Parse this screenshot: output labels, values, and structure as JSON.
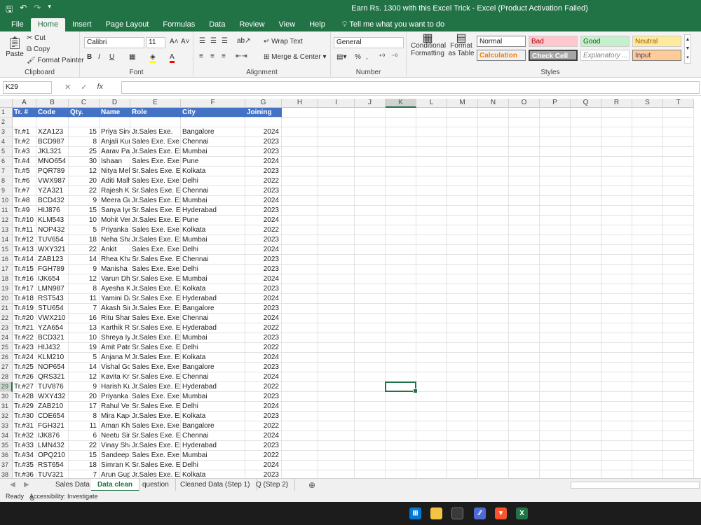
{
  "window": {
    "title": "Earn Rs. 1300 with this Excel Trick  -  Excel (Product Activation Failed)"
  },
  "menu": {
    "tabs": [
      "File",
      "Home",
      "Insert",
      "Page Layout",
      "Formulas",
      "Data",
      "Review",
      "View",
      "Help"
    ],
    "tellme": "Tell me what you want to do"
  },
  "ribbon": {
    "clipboard": {
      "paste": "Paste",
      "cut": "Cut",
      "copy": "Copy",
      "format_painter": "Format Painter",
      "label": "Clipboard"
    },
    "font": {
      "name": "Calibri",
      "size": "11",
      "bold": "B",
      "italic": "I",
      "underline": "U",
      "label": "Font"
    },
    "alignment": {
      "wrap": "Wrap Text",
      "merge": "Merge & Center",
      "label": "Alignment"
    },
    "number": {
      "format": "General",
      "percent": "%",
      "label": "Number"
    },
    "styles": {
      "conditional": "Conditional Formatting",
      "format_table": "Format as Table",
      "normal": "Normal",
      "bad": "Bad",
      "good": "Good",
      "neutral": "Neutral",
      "calculation": "Calculation",
      "check_cell": "Check Cell",
      "explanatory": "Explanatory ...",
      "input": "Input",
      "label": "Styles"
    }
  },
  "formula_bar": {
    "name_box": "K29",
    "fx": "fx",
    "value": ""
  },
  "columns": [
    "A",
    "B",
    "C",
    "D",
    "E",
    "F",
    "G",
    "H",
    "I",
    "J",
    "K",
    "L",
    "M",
    "N",
    "O",
    "P",
    "Q",
    "R",
    "S",
    "T"
  ],
  "selected_column": "K",
  "selected_row": 29,
  "header_row": [
    "Tr. #",
    "Code",
    "Qty.",
    "Name",
    "Role",
    "City",
    "Joining"
  ],
  "rows": [
    [
      "Tr.#1",
      "XZA123",
      "15",
      "Priya Sing",
      "Jr.Sales Exe.",
      "Bangalore",
      "2024"
    ],
    [
      "Tr.#2",
      "BCD987",
      "8",
      "Anjali Kun",
      "Sales Exe. Exe.",
      "Chennai",
      "2023"
    ],
    [
      "Tr.#3",
      "JKL321",
      "25",
      "Aarav Pate",
      "Jr.Sales Exe. Exe",
      "Mumbai",
      "2023"
    ],
    [
      "Tr.#4",
      "MNO654",
      "30",
      "Ishaan",
      "Sales Exe. Exe.",
      "Pune",
      "2024"
    ],
    [
      "Tr.#5",
      "PQR789",
      "12",
      "Nitya Meh",
      "Sr.Sales Exe. Exe",
      "Kolkata",
      "2023"
    ],
    [
      "Tr.#6",
      "VWX987",
      "20",
      "Aditi Malh",
      "Sales Exe. Exe.",
      "Delhi",
      "2022"
    ],
    [
      "Tr.#7",
      "YZA321",
      "22",
      "Rajesh Ku",
      "Sr.Sales Exe. Exe",
      "Chennai",
      "2023"
    ],
    [
      "Tr.#8",
      "BCD432",
      "9",
      "Meera Gu",
      "Jr.Sales Exe. Exe",
      "Mumbai",
      "2024"
    ],
    [
      "Tr.#9",
      "HIJ876",
      "15",
      "Sanya Iyer",
      "Sr.Sales Exe. Exe",
      "Hyderabad",
      "2023"
    ],
    [
      "Tr.#10",
      "KLM543",
      "10",
      "Mohit Ver",
      "Jr.Sales Exe. Exe",
      "Pune",
      "2024"
    ],
    [
      "Tr.#11",
      "NOP432",
      "5",
      "Priyanka F",
      "Sales Exe. Exe.",
      "Kolkata",
      "2022"
    ],
    [
      "Tr.#12",
      "TUV654",
      "18",
      "Neha Shar",
      "Jr.Sales Exe. Exe",
      "Mumbai",
      "2023"
    ],
    [
      "Tr.#13",
      "WXY321",
      "22",
      "Ankit",
      "Sales Exe. Exe.",
      "Delhi",
      "2024"
    ],
    [
      "Tr.#14",
      "ZAB123",
      "14",
      "Rhea Khar",
      "Sr.Sales Exe. Exe",
      "Chennai",
      "2023"
    ],
    [
      "Tr.#15",
      "FGH789",
      "9",
      "Manisha K",
      "Sales Exe. Exe.",
      "Delhi",
      "2023"
    ],
    [
      "Tr.#16",
      "IJK654",
      "12",
      "Varun Dha",
      "Sr.Sales Exe. Exe",
      "Mumbai",
      "2024"
    ],
    [
      "Tr.#17",
      "LMN987",
      "8",
      "Ayesha Ka",
      "Jr.Sales Exe. Exe",
      "Kolkata",
      "2023"
    ],
    [
      "Tr.#18",
      "RST543",
      "11",
      "Yamini Da",
      "Sr.Sales Exe. Exe",
      "Hyderabad",
      "2024"
    ],
    [
      "Tr.#19",
      "STU654",
      "7",
      "Akash Sin",
      "Jr.Sales Exe. Exe",
      "Bangalore",
      "2023"
    ],
    [
      "Tr.#20",
      "VWX210",
      "16",
      "Ritu Sharn",
      "Sales Exe. Exe.",
      "Chennai",
      "2024"
    ],
    [
      "Tr.#21",
      "YZA654",
      "13",
      "Karthik Re",
      "Sr.Sales Exe. Exe",
      "Hyderabad",
      "2022"
    ],
    [
      "Tr.#22",
      "BCD321",
      "10",
      "Shreya Iye",
      "Jr.Sales Exe. Exe",
      "Mumbai",
      "2023"
    ],
    [
      "Tr.#23",
      "HIJ432",
      "19",
      "Amit Pate",
      "Sr.Sales Exe. Exe",
      "Delhi",
      "2022"
    ],
    [
      "Tr.#24",
      "KLM210",
      "5",
      "Anjana Mi",
      "Jr.Sales Exe. Exe",
      "Kolkata",
      "2024"
    ],
    [
      "Tr.#25",
      "NOP654",
      "14",
      "Vishal Go",
      "Sales Exe. Exe.",
      "Bangalore",
      "2023"
    ],
    [
      "Tr.#26",
      "QRS321",
      "12",
      "Kavita Kris",
      "Sr.Sales Exe. Exe",
      "Chennai",
      "2024"
    ],
    [
      "Tr.#27",
      "TUV876",
      "9",
      "Harish Kur",
      "Jr.Sales Exe. Exe",
      "Hyderabad",
      "2022"
    ],
    [
      "Tr.#28",
      "WXY432",
      "20",
      "Priyanka",
      "Sales Exe. Exe.",
      "Mumbai",
      "2023"
    ],
    [
      "Tr.#29",
      "ZAB210",
      "17",
      "Rahul Ver",
      "Sr.Sales Exe. Exe",
      "Delhi",
      "2024"
    ],
    [
      "Tr.#30",
      "CDE654",
      "8",
      "Mira Kapo",
      "Jr.Sales Exe. Exe",
      "Kolkata",
      "2023"
    ],
    [
      "Tr.#31",
      "FGH321",
      "11",
      "Aman Kha",
      "Sales Exe. Exe.",
      "Bangalore",
      "2022"
    ],
    [
      "Tr.#32",
      "IJK876",
      "6",
      "Neetu Sin",
      "Sr.Sales Exe. Exe",
      "Chennai",
      "2024"
    ],
    [
      "Tr.#33",
      "LMN432",
      "22",
      "Vinay Sha",
      "Jr.Sales Exe. Exe",
      "Hyderabad",
      "2023"
    ],
    [
      "Tr.#34",
      "OPQ210",
      "15",
      "Sandeep",
      "Sales Exe. Exe.",
      "Mumbai",
      "2022"
    ],
    [
      "Tr.#35",
      "RST654",
      "18",
      "Simran Ka",
      "Sr.Sales Exe. Exe",
      "Delhi",
      "2024"
    ],
    [
      "Tr.#36",
      "TUV321",
      "7",
      "Arun Gupt",
      "Jr.Sales Exe. Exe",
      "Kolkata",
      "2023"
    ]
  ],
  "sheets": [
    "Sales Data",
    "Data clean",
    "question",
    "Cleaned Data (Step 1)",
    "Q (Step 2)"
  ],
  "active_sheet": "Data clean",
  "status": {
    "ready": "Ready",
    "accessibility": "Accessibility: Investigate"
  },
  "colors": {
    "excel_green": "#217346",
    "header_blue": "#4472c4"
  }
}
